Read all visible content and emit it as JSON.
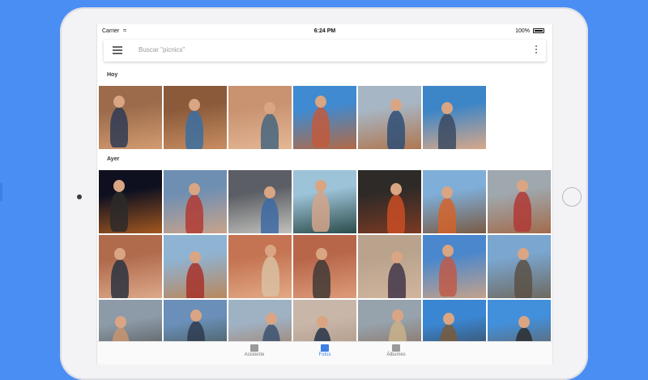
{
  "status_bar": {
    "carrier": "Carrier",
    "time": "6:24 PM",
    "battery": "100%"
  },
  "search": {
    "placeholder": "Buscar \"picnics\""
  },
  "icons": {
    "menu": "menu-icon",
    "more": "more-vert-icon",
    "assistant": "assistant-icon",
    "photos": "photos-icon",
    "albums": "albums-icon"
  },
  "sections": [
    {
      "label": "Hoy",
      "photos": [
        {
          "bg": [
            "#9b6b4c",
            "#d39b6f"
          ],
          "fig": "#2f3b55"
        },
        {
          "bg": [
            "#8a5a3a",
            "#c98d61"
          ],
          "fig": "#3a6ea0"
        },
        {
          "bg": [
            "#c99271",
            "#e4b795"
          ],
          "fig": "#45667f"
        },
        {
          "bg": [
            "#3f8ad1",
            "#b26a45"
          ],
          "fig": "#c15a3d"
        },
        {
          "bg": [
            "#a7b6c4",
            "#b0764f"
          ],
          "fig": "#2f4f75"
        },
        {
          "bg": [
            "#3c85c7",
            "#d8a889"
          ],
          "fig": "#3b4a61"
        }
      ]
    },
    {
      "label": "Ayer",
      "photos": [
        {
          "bg": [
            "#0e1020",
            "#a3571f"
          ],
          "fig": "#2b2a29"
        },
        {
          "bg": [
            "#6f8fb2",
            "#c9a38c"
          ],
          "fig": "#b23b34"
        },
        {
          "bg": [
            "#5b5e64",
            "#c1c0bc"
          ],
          "fig": "#3d6aa4"
        },
        {
          "bg": [
            "#9dc3d8",
            "#2b4c4a"
          ],
          "fig": "#d3a58b"
        },
        {
          "bg": [
            "#2e2a28",
            "#7b3a23"
          ],
          "fig": "#c94d24"
        },
        {
          "bg": [
            "#7faed8",
            "#7a5a43"
          ],
          "fig": "#d2632a"
        },
        {
          "bg": [
            "#9fa8ae",
            "#a26b4c"
          ],
          "fig": "#b03a36"
        },
        {
          "bg": [
            "#b06a4c",
            "#dca88a"
          ],
          "fig": "#2c3342"
        },
        {
          "bg": [
            "#8fb3d3",
            "#b9875c"
          ],
          "fig": "#a7332b"
        },
        {
          "bg": [
            "#c47452",
            "#e3a985"
          ],
          "fig": "#d9c0a2"
        },
        {
          "bg": [
            "#b8664a",
            "#dd9b79"
          ],
          "fig": "#3f3a36"
        },
        {
          "bg": [
            "#b9a38d",
            "#d2b59e"
          ],
          "fig": "#43364a"
        },
        {
          "bg": [
            "#4b87cc",
            "#c4a18b"
          ],
          "fig": "#c05b49"
        },
        {
          "bg": [
            "#7aa6cf",
            "#6e6a61"
          ],
          "fig": "#5b5147"
        },
        {
          "bg": [
            "#8d9ba8",
            "#4b4a48"
          ],
          "fig": "#c8946f"
        },
        {
          "bg": [
            "#6a8fb8",
            "#3d4b3a"
          ],
          "fig": "#2e3b4f"
        },
        {
          "bg": [
            "#9fb2c4",
            "#a27353"
          ],
          "fig": "#3c5270"
        },
        {
          "bg": [
            "#c8b6a8",
            "#a88f7c"
          ],
          "fig": "#263447"
        },
        {
          "bg": [
            "#96a3ad",
            "#8a6249"
          ],
          "fig": "#c9b089"
        },
        {
          "bg": [
            "#3b86d2",
            "#3b3b3b"
          ],
          "fig": "#7a5a3a"
        },
        {
          "bg": [
            "#4290dc",
            "#6e5840"
          ],
          "fig": "#2d2d2d"
        }
      ]
    }
  ],
  "bottom_nav": [
    {
      "label": "Asistente",
      "icon": "assistant-icon",
      "active": false
    },
    {
      "label": "Fotos",
      "icon": "photos-icon",
      "active": true
    },
    {
      "label": "Álbumes",
      "icon": "albums-icon",
      "active": false
    }
  ],
  "colors": {
    "accent": "#3d7fe4",
    "background": "#4a8ef3"
  }
}
